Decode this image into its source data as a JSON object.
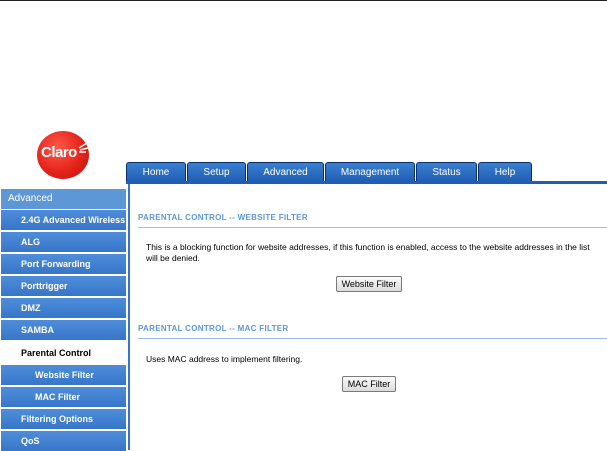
{
  "brand": {
    "logo_text": "Claro",
    "logo_color": "#e4231b"
  },
  "tabs": [
    {
      "label": "Home"
    },
    {
      "label": "Setup"
    },
    {
      "label": "Advanced"
    },
    {
      "label": "Management"
    },
    {
      "label": "Status"
    },
    {
      "label": "Help"
    }
  ],
  "sidebar": {
    "header": "Advanced",
    "items": [
      {
        "label": "2.4G Advanced Wireless"
      },
      {
        "label": "ALG"
      },
      {
        "label": "Port Forwarding"
      },
      {
        "label": "Porttrigger"
      },
      {
        "label": "DMZ"
      },
      {
        "label": "SAMBA"
      },
      {
        "label": "Parental Control",
        "active": true
      },
      {
        "label": "Website Filter"
      },
      {
        "label": "MAC Filter"
      },
      {
        "label": "Filtering Options"
      },
      {
        "label": "QoS"
      }
    ]
  },
  "sections": {
    "website": {
      "title": "PARENTAL CONTROL -- WEBSITE FILTER",
      "description": "This is a blocking function for website addresses, if this function is enabled, access to the website addresses in the list will be denied.",
      "button": "Website Filter"
    },
    "mac": {
      "title": "PARENTAL CONTROL -- MAC FILTER",
      "description": "Uses MAC address to implement filtering.",
      "button": "MAC Filter"
    }
  },
  "colors": {
    "tab_blue": "#1f5eb5",
    "sidebar_blue": "#3776c8",
    "section_title": "#5e97d6"
  }
}
